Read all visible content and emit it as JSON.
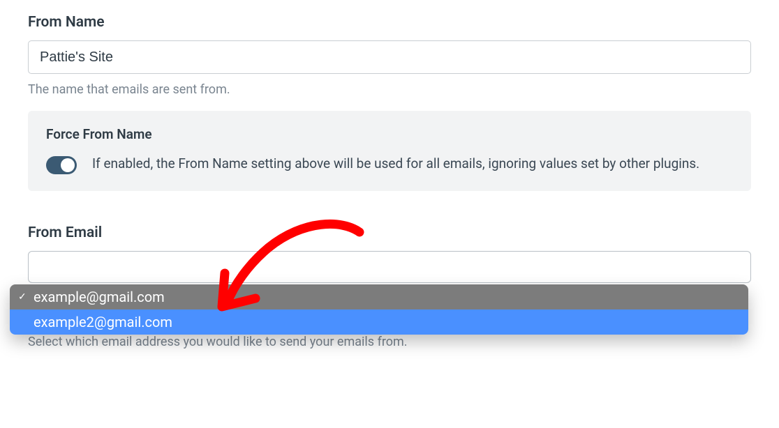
{
  "fromName": {
    "label": "From Name",
    "value": "Pattie's Site",
    "help": "The name that emails are sent from."
  },
  "forceFromName": {
    "title": "Force From Name",
    "enabled": true,
    "description": "If enabled, the From Name setting above will be used for all emails, ignoring values set by other plugins."
  },
  "fromEmail": {
    "label": "From Email",
    "help": "Select which email address you would like to send your emails from.",
    "options": [
      {
        "value": "example@gmail.com",
        "selected": true,
        "highlighted": false
      },
      {
        "value": "example2@gmail.com",
        "selected": false,
        "highlighted": true
      }
    ],
    "checkGlyph": "✓"
  },
  "colors": {
    "toggleOn": "#3b5a73",
    "dropdownSelected": "#7c7c7c",
    "dropdownHighlight": "#4a90ff",
    "arrow": "#ff0000"
  }
}
